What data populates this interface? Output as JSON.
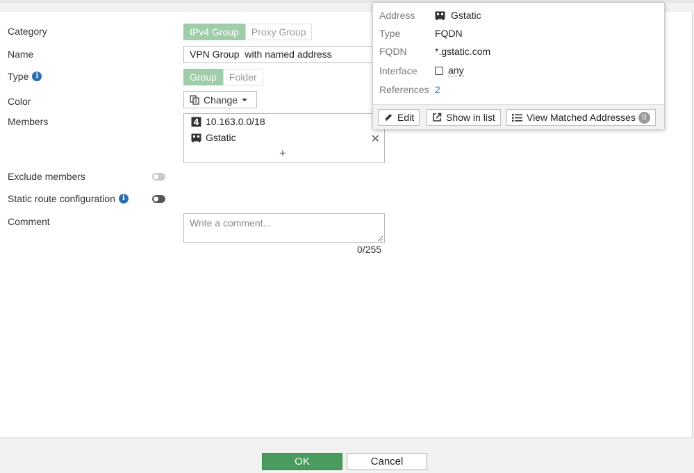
{
  "form": {
    "category_label": "Category",
    "category_options": [
      "IPv4 Group",
      "Proxy Group"
    ],
    "category_selected": "IPv4 Group",
    "name_label": "Name",
    "name_value": "VPN Group  with named address",
    "type_label": "Type",
    "type_options": [
      "Group",
      "Folder"
    ],
    "type_selected": "Group",
    "color_label": "Color",
    "color_button": "Change",
    "members_label": "Members",
    "members": [
      {
        "icon": "subnet-icon",
        "text": "10.163.0.0/18"
      },
      {
        "icon": "fqdn-address-icon",
        "text": "Gstatic"
      }
    ],
    "exclude_label": "Exclude members",
    "static_route_label": "Static route configuration",
    "comment_label": "Comment",
    "comment_placeholder": "Write a comment...",
    "comment_counter": "0/255"
  },
  "tooltip": {
    "address_key": "Address",
    "address_value": "Gstatic",
    "type_key": "Type",
    "type_value": "FQDN",
    "fqdn_key": "FQDN",
    "fqdn_value": "*.gstatic.com",
    "interface_key": "Interface",
    "interface_value": "any",
    "references_key": "References",
    "references_value": "2",
    "edit_button": "Edit",
    "show_in_list_button": "Show in list",
    "view_matched_button": "View Matched Addresses",
    "view_matched_count": "0"
  },
  "footer": {
    "ok_label": "OK",
    "cancel_label": "Cancel"
  },
  "colors": {
    "accent_green": "#4a9b5e",
    "selected_segment": "#9fcda9",
    "link_blue": "#2d6fb0"
  }
}
